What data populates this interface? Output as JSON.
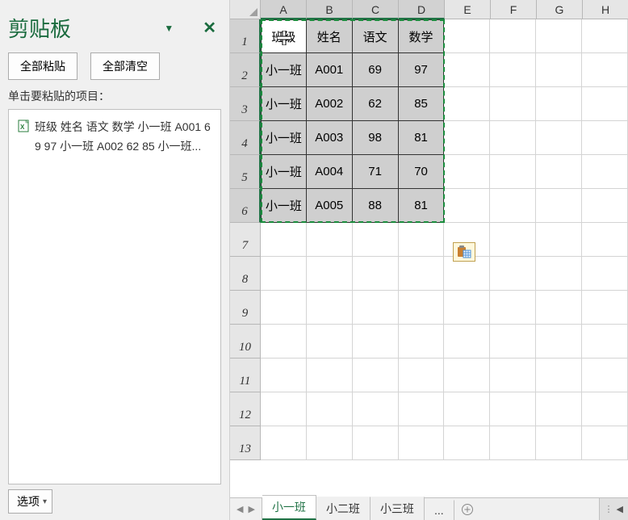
{
  "clipboard": {
    "title": "剪贴板",
    "paste_all_label": "全部粘贴",
    "clear_all_label": "全部清空",
    "instruction": "单击要粘贴的项目：",
    "item_text": "班级 姓名 语文 数学 小一班 A001 69 97 小一班 A002 62 85 小一班...",
    "options_label": "选项"
  },
  "sheet": {
    "columns": [
      "A",
      "B",
      "C",
      "D",
      "E",
      "F",
      "G",
      "H"
    ],
    "row_numbers": [
      "1",
      "2",
      "3",
      "4",
      "5",
      "6",
      "7",
      "8",
      "9",
      "10",
      "11",
      "12",
      "13"
    ],
    "headers": [
      "班级",
      "姓名",
      "语文",
      "数学"
    ],
    "rows": [
      [
        "小一班",
        "A001",
        "69",
        "97"
      ],
      [
        "小一班",
        "A002",
        "62",
        "85"
      ],
      [
        "小一班",
        "A003",
        "98",
        "81"
      ],
      [
        "小一班",
        "A004",
        "71",
        "70"
      ],
      [
        "小一班",
        "A005",
        "88",
        "81"
      ]
    ],
    "visible_empty_rows": 7,
    "tabs": [
      "小一班",
      "小二班",
      "小三班"
    ],
    "active_tab": "小一班",
    "tab_overflow": "..."
  }
}
